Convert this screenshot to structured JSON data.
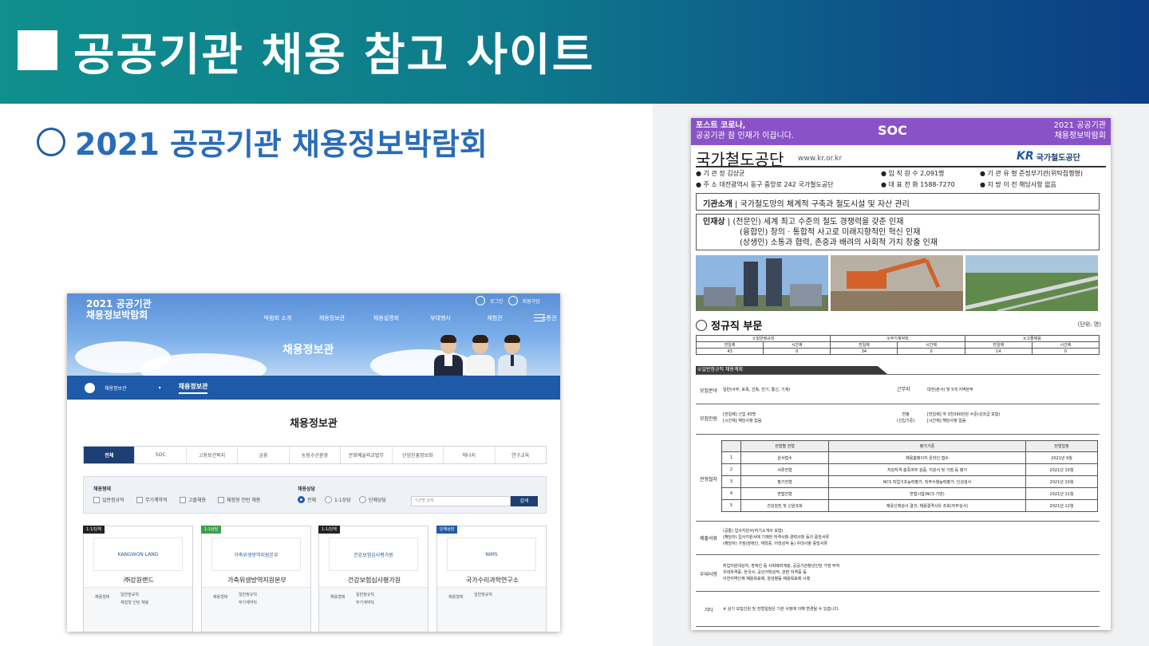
{
  "banner": {
    "title": "공공기관 채용 참고 사이트"
  },
  "subtitle": "2021 공공기관 채용정보박람회",
  "left": {
    "brand_line1": "2021 공공기관",
    "brand_line2": "채용정보박람회",
    "login": "로그인",
    "signup": "회원가입",
    "menu": [
      "박람회 소개",
      "채용정보관",
      "채용설명회",
      "부대행사",
      "체험관",
      "소통관"
    ],
    "hero_title": "채용정보관",
    "nav": {
      "parent": "채용정보관",
      "caret": "▾",
      "current": "채용정보관"
    },
    "section_title": "채용정보관",
    "tabs": [
      "전체",
      "SOC",
      "고용보건복지",
      "금융",
      "농림수산환경",
      "문화예술외교법무",
      "산업진흥정보화",
      "에너지",
      "연구교육"
    ],
    "filter": {
      "type_label": "채용형태",
      "types": [
        "일반정규직",
        "무기계약직",
        "고졸채용",
        "체험형 인턴 채용"
      ],
      "consult_label": "채용상담",
      "consults": [
        "전체",
        "1:1상담",
        "단체상담"
      ],
      "search_placeholder": "기관명 검색",
      "search_button": "검색"
    },
    "cards": [
      {
        "badge": "1:1/단체",
        "badge_color": "#222222",
        "logo": "KANGWON LAND",
        "name": "㈜강원랜드",
        "key": "채용형태",
        "values": [
          "일반정규직",
          "체험형 인턴 채용"
        ]
      },
      {
        "badge": "1:1상담",
        "badge_color": "#3aa14a",
        "logo": "가축위생방역지원본부",
        "name": "가축위생방역지원본부",
        "key": "채용형태",
        "values": [
          "일반정규직",
          "무기계약직"
        ]
      },
      {
        "badge": "1:1/단체",
        "badge_color": "#222222",
        "logo": "건강보험심사평가원",
        "name": "건강보험심사평가원",
        "key": "채용형태",
        "values": [
          "일반정규직",
          "무기계약직"
        ]
      },
      {
        "badge": "단체상담",
        "badge_color": "#1e5aa8",
        "logo": "NIMS",
        "name": "국가수리과학연구소",
        "key": "채용형태",
        "values": [
          "일반정규직"
        ]
      }
    ]
  },
  "doc": {
    "head_left_1": "포스트 코로나,",
    "head_left_2": "공공기관 참 인재가 이끕니다.",
    "head_mid": "SOC",
    "head_right_1": "2021 공공기관",
    "head_right_2": "채용정보박람회",
    "org_name": "국가철도공단",
    "org_url": "www.kr.or.kr",
    "logo_mark": "KR",
    "logo_name": "국가철도공단",
    "info1": [
      "● 기  관  장  김상균",
      "● 임 직 원 수  2,091명",
      "● 기 관 유 형  준정부기관(위탁집행형)"
    ],
    "info2": [
      "● 주       소  대전광역시 동구 중앙로 242 국가철도공단",
      "● 대 표 전 화  1588-7270",
      "● 지 방 이 전  해당사항 없음"
    ],
    "about_label": "기관소개",
    "about": "국가철도망의 체계적 구축과 철도시설 및 자산 관리",
    "talent_label": "인재상",
    "talent": [
      "(전문인) 세계 최고 수준의 철도 경쟁력을 갖춘 인재",
      "(융합인) 창의 · 통합적 사고로 미래지향적인 혁신 인재",
      "(상생인) 소통과 협력, 존중과 배려의 사회적 가치 창출 인재"
    ],
    "regular_title": "정규직 부문",
    "unit": "(단위: 명)",
    "t1_groups": [
      "①일반정규직",
      "②무기계약직",
      "③고졸채용"
    ],
    "t1_sub": [
      "전일제",
      "시간제",
      "전일제",
      "시간제",
      "전일제",
      "시간제"
    ],
    "t1_vals": [
      "43",
      "0",
      "34",
      "0",
      "14",
      "0"
    ],
    "plan_bar": "①일반정규직 채용계획",
    "field_label": "모집분야",
    "field": "일반(사무, 토목, 건축, 전기, 통신, 기계)",
    "work_label": "근무지",
    "work": "대전(본사) 및 5개 지역본부",
    "people_label": "모집인원",
    "people": [
      "[전일제] 신입 43명",
      "[시간제] 해당사항 없음"
    ],
    "salary_label": "연봉",
    "salary_sub": "(신입기준)",
    "salary": [
      "[전일제] 약 3천390만원 수준(성과급 포함)",
      "[시간제] 해당사항 없음"
    ],
    "process_label": "전형절차",
    "t2_head": [
      "",
      "전형별 전형",
      "평가기준",
      "전형일정"
    ],
    "t2_rows": [
      [
        "1",
        "원서접수",
        "채용홈페이지 온라인 접수",
        "2021년 9월"
      ],
      [
        "2",
        "서류전형",
        "지원자격 충족여부 검증, 지원서 및 가점 등 평가",
        "2021년 10월"
      ],
      [
        "3",
        "필기전형",
        "NCS 직업기초능력평가, 직무수행능력평가, 인성검사",
        "2021년 10월"
      ],
      [
        "4",
        "면접전형",
        "면접시험(NCS 기반)",
        "2021년 11월"
      ],
      [
        "5",
        "건강검진 및 신원조회",
        "채용신체검사 결과, 채용결격사유 조회(자부심사)",
        "2021년 12월"
      ]
    ],
    "docs_label": "제출서류",
    "docs": [
      "(공통) 입사지원서(자기소개서 포함)",
      "(해당자) 입사지원서에 기재한 자격사항·경력사항 등의 증빙서류",
      "(해당자) 가점(장애인, 재학중, 어학성적 등) 우대사항 증빙서류"
    ],
    "pref_label": "우대사항",
    "pref": [
      "취업지원대상자, 장애인 등 사회배려계층, 공공기관청년인턴 가점 부여",
      "우대자격증: 한국사, 공인어학성적, 관련 자격증 등",
      "이전지역인재 채용목표제, 양성평등 채용목표제 시행"
    ],
    "etc_label": "기타",
    "etc": "※ 상기 모집인원 및 전형일정은 기관 사정에 의해 변경될 수 있습니다."
  }
}
